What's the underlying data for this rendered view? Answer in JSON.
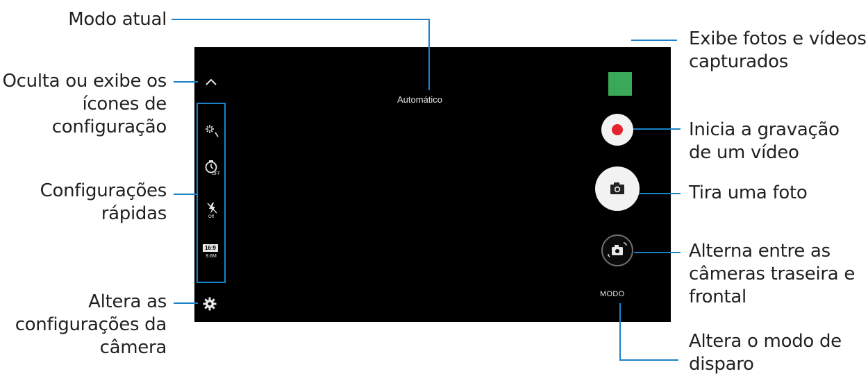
{
  "screen": {
    "mode_label": "Automático",
    "mode_button": "MODO",
    "quick_settings": {
      "aspect_ratio": "16:9",
      "resolution": "9.6M",
      "timer_state": "OFF",
      "flash_state": "Off"
    },
    "icons": {
      "collapse": "chevron-up-icon",
      "filter": "sparkle-effect-icon",
      "timer": "timer-off-icon",
      "flash": "flash-off-icon",
      "settings": "gear-icon",
      "record": "record-icon",
      "capture": "camera-icon",
      "switch": "switch-camera-icon"
    },
    "colors": {
      "gallery_thumbnail": "#3aa957",
      "record_dot": "#e5222e",
      "callout_line": "#1a82c7"
    }
  },
  "callouts": {
    "current_mode": {
      "lines": [
        "Modo atual"
      ]
    },
    "toggle_icons": {
      "lines": [
        "Oculta ou exibe os",
        "ícones de",
        "configuração"
      ]
    },
    "quick_settings": {
      "lines": [
        "Configurações",
        "rápidas"
      ]
    },
    "camera_settings": {
      "lines": [
        "Altera as",
        "configurações da",
        "câmera"
      ]
    },
    "gallery": {
      "lines": [
        "Exibe fotos e vídeos",
        "capturados"
      ]
    },
    "record": {
      "lines": [
        "Inicia a gravação",
        "de um vídeo"
      ]
    },
    "photo": {
      "lines": [
        "Tira uma foto"
      ]
    },
    "switch": {
      "lines": [
        "Alterna entre as",
        "câmeras traseira e",
        "frontal"
      ]
    },
    "mode": {
      "lines": [
        "Altera o modo de",
        "disparo"
      ]
    }
  }
}
